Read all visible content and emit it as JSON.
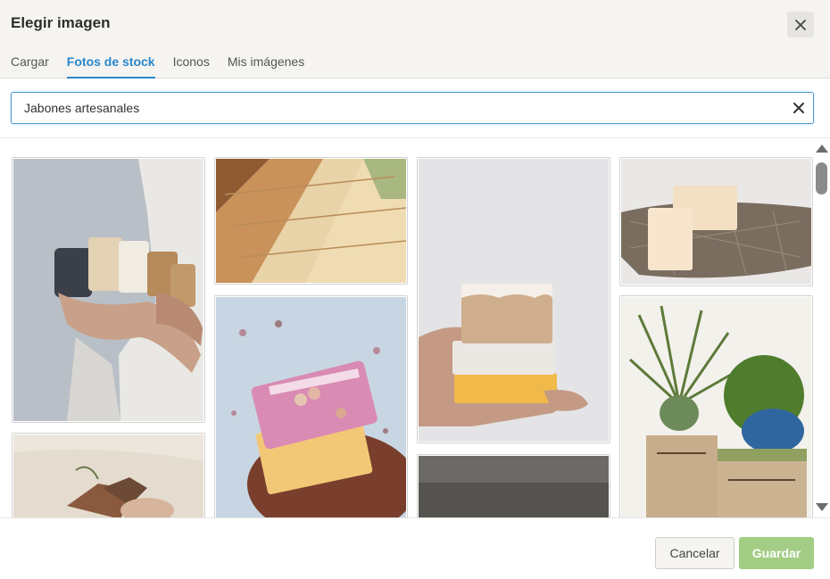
{
  "dialog": {
    "title": "Elegir imagen"
  },
  "tabs": [
    {
      "label": "Cargar",
      "active": false
    },
    {
      "label": "Fotos de stock",
      "active": true
    },
    {
      "label": "Iconos",
      "active": false
    },
    {
      "label": "Mis imágenes",
      "active": false
    }
  ],
  "search": {
    "value": "Jabones artesanales",
    "placeholder": ""
  },
  "footer": {
    "cancel_label": "Cancelar",
    "save_label": "Guardar"
  },
  "colors": {
    "accent": "#2a86c9",
    "save": "#a3cd84",
    "header_bg": "#f5f4f1"
  },
  "icons": {
    "close": "close-icon",
    "clear": "clear-icon"
  }
}
